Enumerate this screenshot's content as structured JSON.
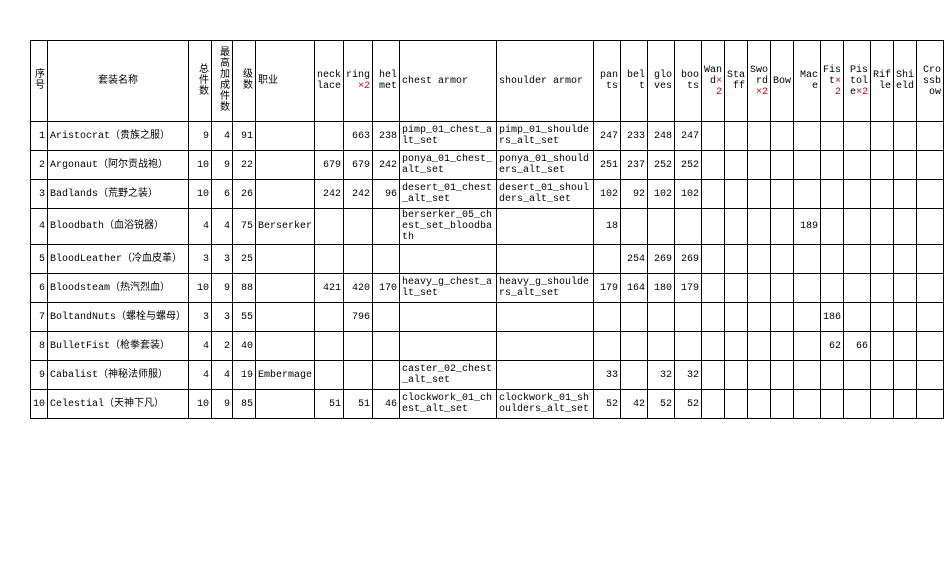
{
  "headers": {
    "idx": "序号",
    "name": "套装名称",
    "tot": "总件数",
    "hi": "最高加成件数",
    "lvl": "级数",
    "job": "职业",
    "neck": "necklace",
    "ring_a": "ring",
    "ring_b": "×2",
    "helm": "helmet",
    "chest": "chest armor",
    "shoulder": "shoulder armor",
    "pants": "pants",
    "belt": "belt",
    "gloves": "gloves",
    "boots": "boots",
    "wand_a": "Wand",
    "wand_b": "×2",
    "staff": "Staff",
    "sword_a": "Sword",
    "sword_b": "×2",
    "bow": "Bow",
    "mace": "Mace",
    "fist_a": "Fist",
    "fist_b": "×2",
    "pist_a": "Pistole",
    "pist_b": "×2",
    "rifle": "Rifle",
    "shield": "Shield",
    "crossbow": "Crossbow"
  },
  "rows": [
    {
      "idx": "1",
      "name": "Aristocrat（贵族之服）",
      "tot": "9",
      "hi": "4",
      "lvl": "91",
      "job": "",
      "neck": "",
      "ring": "663",
      "helm": "238",
      "chest": "pimp_01_chest_alt_set",
      "shoulder": "pimp_01_shoulders_alt_set",
      "pants": "247",
      "belt": "233",
      "gloves": "248",
      "boots": "247",
      "wand": "",
      "staff": "",
      "sword": "",
      "bow": "",
      "mace": "",
      "fist": "",
      "pist": "",
      "rif": "",
      "shi": "",
      "cross": ""
    },
    {
      "idx": "2",
      "name": "Argonaut（阿尔贡战袍）",
      "tot": "10",
      "hi": "9",
      "lvl": "22",
      "job": "",
      "neck": "679",
      "ring": "679",
      "helm": "242",
      "chest": "ponya_01_chest_alt_set",
      "shoulder": "ponya_01_shoulders_alt_set",
      "pants": "251",
      "belt": "237",
      "gloves": "252",
      "boots": "252",
      "wand": "",
      "staff": "",
      "sword": "",
      "bow": "",
      "mace": "",
      "fist": "",
      "pist": "",
      "rif": "",
      "shi": "",
      "cross": ""
    },
    {
      "idx": "3",
      "name": "Badlands（荒野之装）",
      "tot": "10",
      "hi": "6",
      "lvl": "26",
      "job": "",
      "neck": "242",
      "ring": "242",
      "helm": "96",
      "chest": "desert_01_chest_alt_set",
      "shoulder": "desert_01_shoulders_alt_set",
      "pants": "102",
      "belt": "92",
      "gloves": "102",
      "boots": "102",
      "wand": "",
      "staff": "",
      "sword": "",
      "bow": "",
      "mace": "",
      "fist": "",
      "pist": "",
      "rif": "",
      "shi": "",
      "cross": ""
    },
    {
      "idx": "4",
      "name": "Bloodbath（血浴锐器）",
      "tot": "4",
      "hi": "4",
      "lvl": "75",
      "job": "Berserker",
      "neck": "",
      "ring": "",
      "helm": "",
      "chest": "berserker_05_chest_set_bloodbath",
      "shoulder": "",
      "pants": "18",
      "belt": "",
      "gloves": "",
      "boots": "",
      "wand": "",
      "staff": "",
      "sword": "",
      "bow": "",
      "mace": "189",
      "fist": "",
      "pist": "",
      "rif": "",
      "shi": "",
      "cross": ""
    },
    {
      "idx": "5",
      "name": "BloodLeather（冷血皮革）",
      "tot": "3",
      "hi": "3",
      "lvl": "25",
      "job": "",
      "neck": "",
      "ring": "",
      "helm": "",
      "chest": "",
      "shoulder": "",
      "pants": "",
      "belt": "254",
      "gloves": "269",
      "boots": "269",
      "wand": "",
      "staff": "",
      "sword": "",
      "bow": "",
      "mace": "",
      "fist": "",
      "pist": "",
      "rif": "",
      "shi": "",
      "cross": ""
    },
    {
      "idx": "6",
      "name": "Bloodsteam（热汽烈血）",
      "tot": "10",
      "hi": "9",
      "lvl": "88",
      "job": "",
      "neck": "421",
      "ring": "420",
      "helm": "170",
      "chest": "heavy_g_chest_alt_set",
      "shoulder": "heavy_g_shoulders_alt_set",
      "pants": "179",
      "belt": "164",
      "gloves": "180",
      "boots": "179",
      "wand": "",
      "staff": "",
      "sword": "",
      "bow": "",
      "mace": "",
      "fist": "",
      "pist": "",
      "rif": "",
      "shi": "",
      "cross": ""
    },
    {
      "idx": "7",
      "name": "BoltandNuts（螺栓与螺母）",
      "tot": "3",
      "hi": "3",
      "lvl": "55",
      "job": "",
      "neck": "",
      "ring": "796",
      "helm": "",
      "chest": "",
      "shoulder": "",
      "pants": "",
      "belt": "",
      "gloves": "",
      "boots": "",
      "wand": "",
      "staff": "",
      "sword": "",
      "bow": "",
      "mace": "",
      "fist": "186",
      "pist": "",
      "rif": "",
      "shi": "",
      "cross": ""
    },
    {
      "idx": "8",
      "name": "BulletFist（枪拳套装）",
      "tot": "4",
      "hi": "2",
      "lvl": "40",
      "job": "",
      "neck": "",
      "ring": "",
      "helm": "",
      "chest": "",
      "shoulder": "",
      "pants": "",
      "belt": "",
      "gloves": "",
      "boots": "",
      "wand": "",
      "staff": "",
      "sword": "",
      "bow": "",
      "mace": "",
      "fist": "62",
      "pist": "66",
      "rif": "",
      "shi": "",
      "cross": ""
    },
    {
      "idx": "9",
      "name": "Cabalist（神秘法师服）",
      "tot": "4",
      "hi": "4",
      "lvl": "19",
      "job": "Embermage",
      "neck": "",
      "ring": "",
      "helm": "",
      "chest": "caster_02_chest_alt_set",
      "shoulder": "",
      "pants": "33",
      "belt": "",
      "gloves": "32",
      "boots": "32",
      "wand": "",
      "staff": "",
      "sword": "",
      "bow": "",
      "mace": "",
      "fist": "",
      "pist": "",
      "rif": "",
      "shi": "",
      "cross": ""
    },
    {
      "idx": "10",
      "name": "Celestial（天神下凡）",
      "tot": "10",
      "hi": "9",
      "lvl": "85",
      "job": "",
      "neck": "51",
      "ring": "51",
      "helm": "46",
      "chest": "clockwork_01_chest_alt_set",
      "shoulder": "clockwork_01_shoulders_alt_set",
      "pants": "52",
      "belt": "42",
      "gloves": "52",
      "boots": "52",
      "wand": "",
      "staff": "",
      "sword": "",
      "bow": "",
      "mace": "",
      "fist": "",
      "pist": "",
      "rif": "",
      "shi": "",
      "cross": ""
    }
  ]
}
